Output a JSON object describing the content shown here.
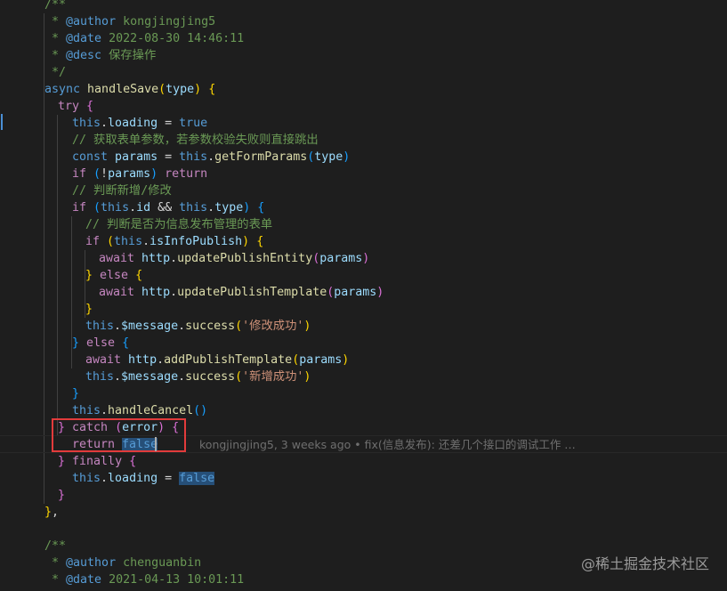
{
  "editor": {
    "lines": [
      {
        "indent": 50,
        "tokens": [
          {
            "t": "/**",
            "c": "c"
          }
        ]
      },
      {
        "indent": 50,
        "tokens": [
          {
            "t": " * ",
            "c": "c"
          },
          {
            "t": "@author",
            "c": "k"
          },
          {
            "t": " kongjingjing5",
            "c": "c"
          }
        ]
      },
      {
        "indent": 50,
        "tokens": [
          {
            "t": " * ",
            "c": "c"
          },
          {
            "t": "@date",
            "c": "k"
          },
          {
            "t": " 2022-08-30 14:46:11",
            "c": "c"
          }
        ]
      },
      {
        "indent": 50,
        "tokens": [
          {
            "t": " * ",
            "c": "c"
          },
          {
            "t": "@desc",
            "c": "k"
          },
          {
            "t": " 保存操作",
            "c": "c"
          }
        ]
      },
      {
        "indent": 50,
        "tokens": [
          {
            "t": " */",
            "c": "c"
          }
        ]
      },
      {
        "indent": 50,
        "tokens": [
          {
            "t": "async ",
            "c": "k"
          },
          {
            "t": "handleSave",
            "c": "f"
          },
          {
            "t": "(",
            "c": "y"
          },
          {
            "t": "type",
            "c": "v"
          },
          {
            "t": ")",
            "c": "y"
          },
          {
            "t": " ",
            "c": "p"
          },
          {
            "t": "{",
            "c": "y"
          }
        ]
      },
      {
        "indent": 65,
        "tokens": [
          {
            "t": "try ",
            "c": "kw"
          },
          {
            "t": "{",
            "c": "pk"
          }
        ]
      },
      {
        "indent": 81,
        "tokens": [
          {
            "t": "this",
            "c": "k"
          },
          {
            "t": ".",
            "c": "p"
          },
          {
            "t": "loading",
            "c": "v"
          },
          {
            "t": " = ",
            "c": "p"
          },
          {
            "t": "true",
            "c": "k"
          }
        ]
      },
      {
        "indent": 81,
        "tokens": [
          {
            "t": "// 获取表单参数，若参数校验失败则直接跳出",
            "c": "c"
          }
        ]
      },
      {
        "indent": 81,
        "tokens": [
          {
            "t": "const ",
            "c": "k"
          },
          {
            "t": "params",
            "c": "v"
          },
          {
            "t": " = ",
            "c": "p"
          },
          {
            "t": "this",
            "c": "k"
          },
          {
            "t": ".",
            "c": "p"
          },
          {
            "t": "getFormParams",
            "c": "f"
          },
          {
            "t": "(",
            "c": "b"
          },
          {
            "t": "type",
            "c": "v"
          },
          {
            "t": ")",
            "c": "b"
          }
        ]
      },
      {
        "indent": 81,
        "tokens": [
          {
            "t": "if ",
            "c": "kw"
          },
          {
            "t": "(",
            "c": "b"
          },
          {
            "t": "!",
            "c": "p"
          },
          {
            "t": "params",
            "c": "v"
          },
          {
            "t": ") ",
            "c": "b"
          },
          {
            "t": "return",
            "c": "kw"
          }
        ]
      },
      {
        "indent": 81,
        "tokens": [
          {
            "t": "// 判断新增/修改",
            "c": "c"
          }
        ]
      },
      {
        "indent": 81,
        "tokens": [
          {
            "t": "if ",
            "c": "kw"
          },
          {
            "t": "(",
            "c": "b"
          },
          {
            "t": "this",
            "c": "k"
          },
          {
            "t": ".",
            "c": "p"
          },
          {
            "t": "id",
            "c": "v"
          },
          {
            "t": " && ",
            "c": "p"
          },
          {
            "t": "this",
            "c": "k"
          },
          {
            "t": ".",
            "c": "p"
          },
          {
            "t": "type",
            "c": "v"
          },
          {
            "t": ")",
            "c": "b"
          },
          {
            "t": " ",
            "c": "p"
          },
          {
            "t": "{",
            "c": "b"
          }
        ]
      },
      {
        "indent": 96,
        "tokens": [
          {
            "t": "// 判断是否为信息发布管理的表单",
            "c": "c"
          }
        ]
      },
      {
        "indent": 96,
        "tokens": [
          {
            "t": "if ",
            "c": "kw"
          },
          {
            "t": "(",
            "c": "y"
          },
          {
            "t": "this",
            "c": "k"
          },
          {
            "t": ".",
            "c": "p"
          },
          {
            "t": "isInfoPublish",
            "c": "v"
          },
          {
            "t": ")",
            "c": "y"
          },
          {
            "t": " ",
            "c": "p"
          },
          {
            "t": "{",
            "c": "y"
          }
        ]
      },
      {
        "indent": 111,
        "tokens": [
          {
            "t": "await ",
            "c": "kw"
          },
          {
            "t": "http",
            "c": "v"
          },
          {
            "t": ".",
            "c": "p"
          },
          {
            "t": "updatePublishEntity",
            "c": "f"
          },
          {
            "t": "(",
            "c": "pk"
          },
          {
            "t": "params",
            "c": "v"
          },
          {
            "t": ")",
            "c": "pk"
          }
        ]
      },
      {
        "indent": 96,
        "tokens": [
          {
            "t": "}",
            "c": "y"
          },
          {
            "t": " ",
            "c": "p"
          },
          {
            "t": "else ",
            "c": "kw"
          },
          {
            "t": "{",
            "c": "y"
          }
        ]
      },
      {
        "indent": 111,
        "tokens": [
          {
            "t": "await ",
            "c": "kw"
          },
          {
            "t": "http",
            "c": "v"
          },
          {
            "t": ".",
            "c": "p"
          },
          {
            "t": "updatePublishTemplate",
            "c": "f"
          },
          {
            "t": "(",
            "c": "pk"
          },
          {
            "t": "params",
            "c": "v"
          },
          {
            "t": ")",
            "c": "pk"
          }
        ]
      },
      {
        "indent": 96,
        "tokens": [
          {
            "t": "}",
            "c": "y"
          }
        ]
      },
      {
        "indent": 96,
        "tokens": [
          {
            "t": "this",
            "c": "k"
          },
          {
            "t": ".",
            "c": "p"
          },
          {
            "t": "$message",
            "c": "v"
          },
          {
            "t": ".",
            "c": "p"
          },
          {
            "t": "success",
            "c": "f"
          },
          {
            "t": "(",
            "c": "y"
          },
          {
            "t": "'修改成功'",
            "c": "s"
          },
          {
            "t": ")",
            "c": "y"
          }
        ]
      },
      {
        "indent": 81,
        "tokens": [
          {
            "t": "}",
            "c": "b"
          },
          {
            "t": " ",
            "c": "p"
          },
          {
            "t": "else ",
            "c": "kw"
          },
          {
            "t": "{",
            "c": "b"
          }
        ]
      },
      {
        "indent": 96,
        "tokens": [
          {
            "t": "await ",
            "c": "kw"
          },
          {
            "t": "http",
            "c": "v"
          },
          {
            "t": ".",
            "c": "p"
          },
          {
            "t": "addPublishTemplate",
            "c": "f"
          },
          {
            "t": "(",
            "c": "y"
          },
          {
            "t": "params",
            "c": "v"
          },
          {
            "t": ")",
            "c": "y"
          }
        ]
      },
      {
        "indent": 96,
        "tokens": [
          {
            "t": "this",
            "c": "k"
          },
          {
            "t": ".",
            "c": "p"
          },
          {
            "t": "$message",
            "c": "v"
          },
          {
            "t": ".",
            "c": "p"
          },
          {
            "t": "success",
            "c": "f"
          },
          {
            "t": "(",
            "c": "y"
          },
          {
            "t": "'新增成功'",
            "c": "s"
          },
          {
            "t": ")",
            "c": "y"
          }
        ]
      },
      {
        "indent": 81,
        "tokens": [
          {
            "t": "}",
            "c": "b"
          }
        ]
      },
      {
        "indent": 81,
        "tokens": [
          {
            "t": "this",
            "c": "k"
          },
          {
            "t": ".",
            "c": "p"
          },
          {
            "t": "handleCancel",
            "c": "f"
          },
          {
            "t": "()",
            "c": "b"
          }
        ]
      },
      {
        "indent": 65,
        "tokens": [
          {
            "t": "}",
            "c": "pk"
          },
          {
            "t": " ",
            "c": "p"
          },
          {
            "t": "catch ",
            "c": "kw"
          },
          {
            "t": "(",
            "c": "pk"
          },
          {
            "t": "error",
            "c": "v"
          },
          {
            "t": ")",
            "c": "pk"
          },
          {
            "t": " ",
            "c": "p"
          },
          {
            "t": "{",
            "c": "pk"
          }
        ]
      },
      {
        "indent": 81,
        "tokens": [
          {
            "t": "return ",
            "c": "kw"
          },
          {
            "t": "false",
            "c": "k",
            "sel": true
          }
        ]
      },
      {
        "indent": 65,
        "tokens": [
          {
            "t": "}",
            "c": "pk"
          },
          {
            "t": " ",
            "c": "p"
          },
          {
            "t": "finally ",
            "c": "kw"
          },
          {
            "t": "{",
            "c": "pk"
          }
        ]
      },
      {
        "indent": 81,
        "tokens": [
          {
            "t": "this",
            "c": "k"
          },
          {
            "t": ".",
            "c": "p"
          },
          {
            "t": "loading",
            "c": "v"
          },
          {
            "t": " = ",
            "c": "p"
          },
          {
            "t": "false",
            "c": "k",
            "sel": true
          }
        ]
      },
      {
        "indent": 65,
        "tokens": [
          {
            "t": "}",
            "c": "pk"
          }
        ]
      },
      {
        "indent": 50,
        "tokens": [
          {
            "t": "}",
            "c": "y"
          },
          {
            "t": ",",
            "c": "p"
          }
        ]
      },
      {
        "indent": 50,
        "tokens": []
      },
      {
        "indent": 50,
        "tokens": [
          {
            "t": "/**",
            "c": "c"
          }
        ]
      },
      {
        "indent": 50,
        "tokens": [
          {
            "t": " * ",
            "c": "c"
          },
          {
            "t": "@author",
            "c": "k"
          },
          {
            "t": " chenguanbin",
            "c": "c"
          }
        ]
      },
      {
        "indent": 50,
        "tokens": [
          {
            "t": " * ",
            "c": "c"
          },
          {
            "t": "@date",
            "c": "k"
          },
          {
            "t": " 2021-04-13 10:01:11",
            "c": "c"
          }
        ]
      }
    ]
  },
  "blame": {
    "text": "kongjingjing5, 3 weeks ago • fix(信息发布): 还差几个接口的调试工作 …"
  },
  "watermark": {
    "text": "@稀土掘金技术社区"
  },
  "colors": {
    "background": "#1e1e1e",
    "highlight_box": "#e23b3b",
    "selection": "#264f78"
  }
}
